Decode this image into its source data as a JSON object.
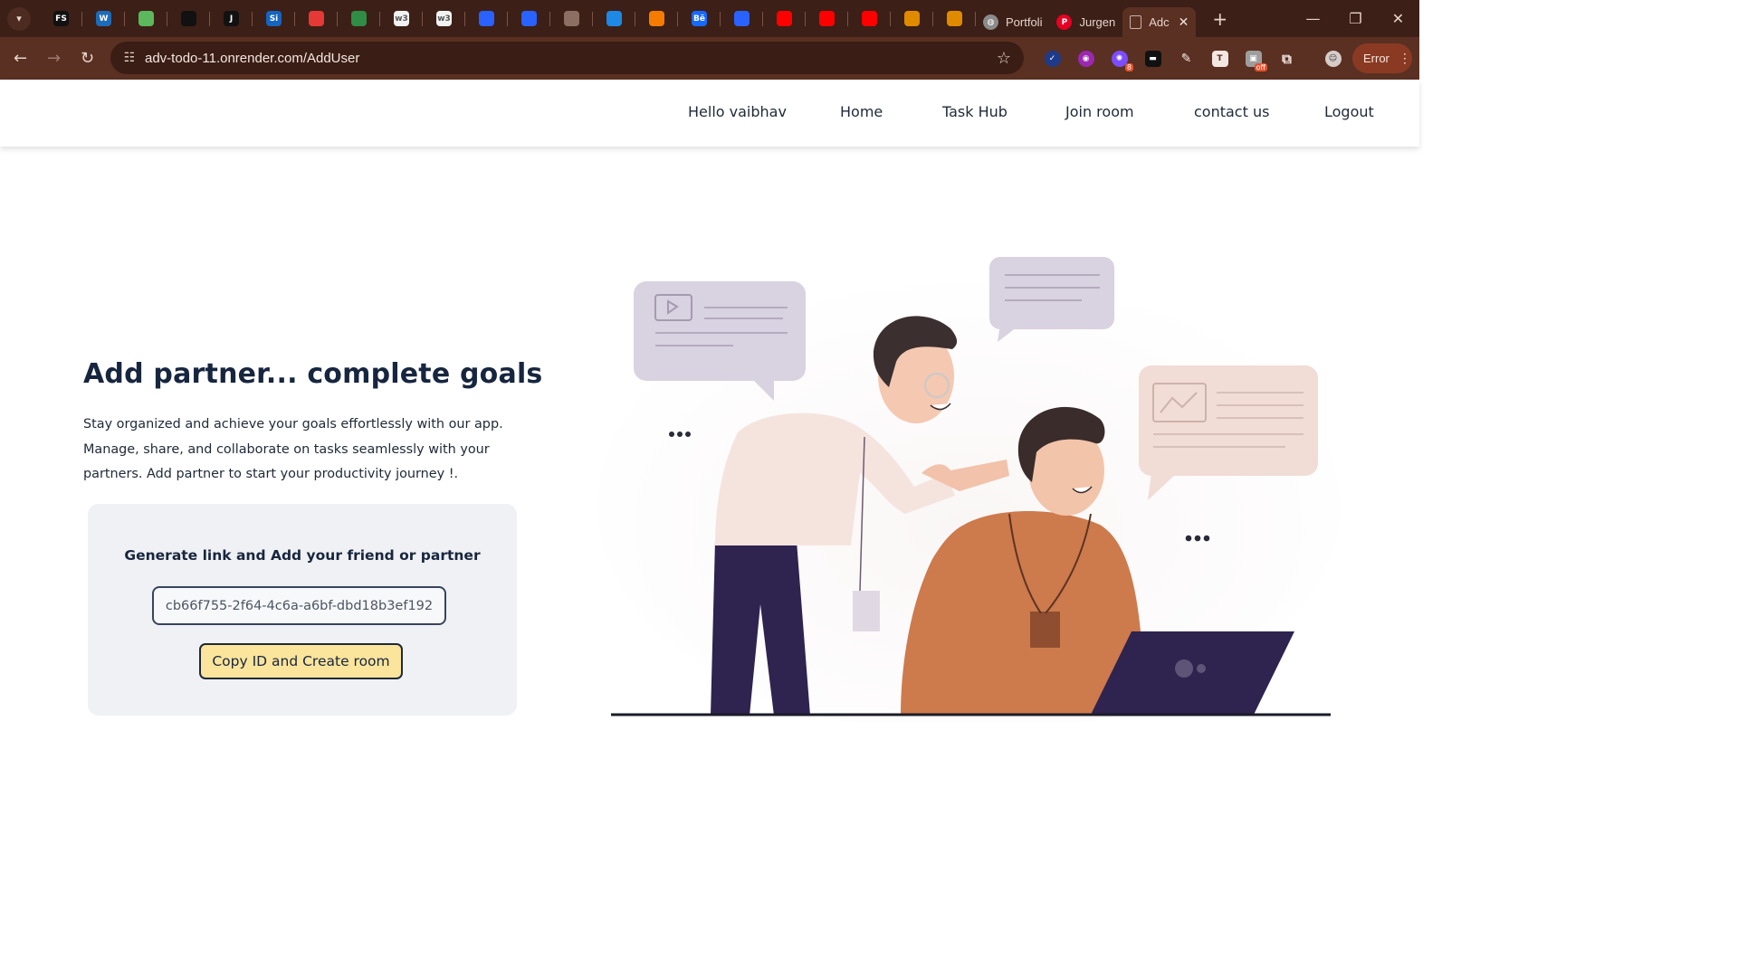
{
  "browser": {
    "pinned_tabs": [
      {
        "icon": "fs-icon",
        "text": "FS",
        "color": "#111111"
      },
      {
        "icon": "w-logo-icon",
        "text": "W",
        "color": "#1e6bb8"
      },
      {
        "icon": "green-logo-icon",
        "text": "",
        "color": "#5cb85c"
      },
      {
        "icon": "clock-icon",
        "text": "",
        "color": "#111111"
      },
      {
        "icon": "j-logo-icon",
        "text": "J",
        "color": "#111111"
      },
      {
        "icon": "si-logo-icon",
        "text": "Si",
        "color": "#1565c0"
      },
      {
        "icon": "oracle-icon",
        "text": "",
        "color": "#e53935"
      },
      {
        "icon": "gfg-icon",
        "text": "",
        "color": "#2f8d46"
      },
      {
        "icon": "w3schools-icon",
        "text": "w3",
        "color": "#f2f2f2"
      },
      {
        "icon": "w3schools-icon",
        "text": "w3",
        "color": "#f2f2f2"
      },
      {
        "icon": "rupee-icon",
        "text": "",
        "color": "#2962ff"
      },
      {
        "icon": "rupee-icon",
        "text": "",
        "color": "#2962ff"
      },
      {
        "icon": "network-icon",
        "text": "",
        "color": "#8d6e63"
      },
      {
        "icon": "globe-logo-icon",
        "text": "",
        "color": "#1e88e5"
      },
      {
        "icon": "sketch-icon",
        "text": "",
        "color": "#f57c00"
      },
      {
        "icon": "behance-icon",
        "text": "Bē",
        "color": "#1769ff"
      },
      {
        "icon": "play-circle-icon",
        "text": "",
        "color": "#2962ff"
      },
      {
        "icon": "youtube-icon",
        "text": "",
        "color": "#ff0000"
      },
      {
        "icon": "youtube-icon",
        "text": "",
        "color": "#ff0000"
      },
      {
        "icon": "youtube-icon",
        "text": "",
        "color": "#ff0000"
      },
      {
        "icon": "figure-icon",
        "text": "",
        "color": "#e08a00"
      },
      {
        "icon": "figure-icon",
        "text": "",
        "color": "#e08a00"
      }
    ],
    "tabs": [
      {
        "label": "Portfoli",
        "icon": "globe-icon"
      },
      {
        "label": "Jurgen",
        "icon": "pinterest-icon"
      },
      {
        "label": "Adc",
        "icon": "page-icon"
      }
    ],
    "url": "adv-todo-11.onrender.com/AddUser",
    "extension_badges": {
      "notifications": "8",
      "toggle": "off"
    },
    "error_label": "Error"
  },
  "nav": {
    "greeting": "Hello vaibhav",
    "home": "Home",
    "task_hub": "Task Hub",
    "join_room": "Join room",
    "contact": "contact us",
    "logout": "Logout"
  },
  "hero": {
    "headline": "Add partner... complete goals",
    "description": "Stay organized and achieve your goals effortlessly with our app. Manage, share, and collaborate on tasks seamlessly with your partners. Add partner to start your productivity journey !."
  },
  "card": {
    "title": "Generate link and Add your friend or partner",
    "room_id": "cb66f755-2f64-4c6a-a6bf-dbd18b3ef192",
    "button_label": "Copy ID and Create room"
  },
  "colors": {
    "heading": "#17263f",
    "button_fill": "#fbe49b",
    "card_bg": "#f0f1f4",
    "browser_frame": "#5a3022"
  }
}
